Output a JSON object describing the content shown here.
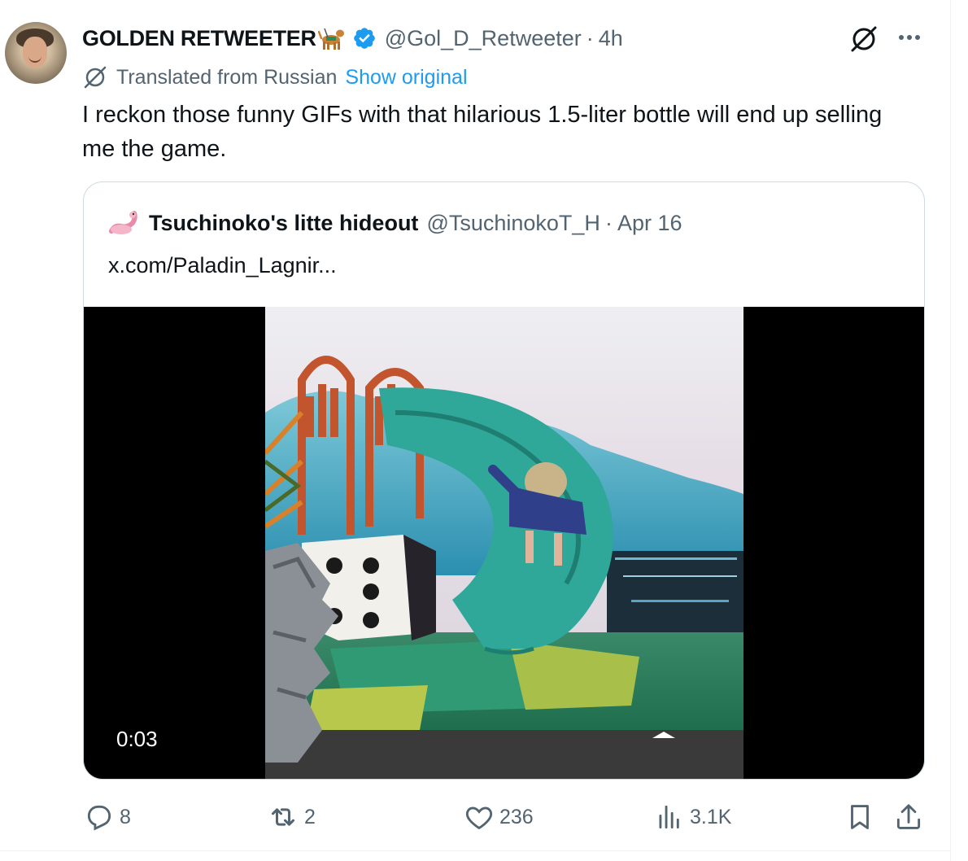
{
  "tweet": {
    "display_name": "GOLDEN RETWEETER",
    "handle": "@Gol_D_Retweeter",
    "separator": "·",
    "time": "4h",
    "translated_label": "Translated from Russian",
    "show_original_label": "Show original",
    "text": "I reckon those funny GIFs with that hilarious 1.5-liter bottle will end up selling me the game."
  },
  "quote": {
    "display_name": "Tsuchinoko's litte hideout",
    "handle": "@TsuchinokoT_H",
    "separator": "·",
    "date": "Apr 16",
    "text": "x.com/Paladin_Lagnir...",
    "video_duration": "0:03"
  },
  "actions": {
    "replies": "8",
    "retweets": "2",
    "likes": "236",
    "views": "3.1K"
  },
  "icons": {
    "verified": "verified-badge-icon",
    "grok": "grok-icon",
    "more": "more-icon",
    "reply": "reply-icon",
    "retweet": "retweet-icon",
    "like": "heart-icon",
    "views": "views-icon",
    "bookmark": "bookmark-icon",
    "share": "share-icon"
  },
  "colors": {
    "accent": "#1d9bf0",
    "secondary_text": "#536471",
    "primary_text": "#0f1419"
  }
}
